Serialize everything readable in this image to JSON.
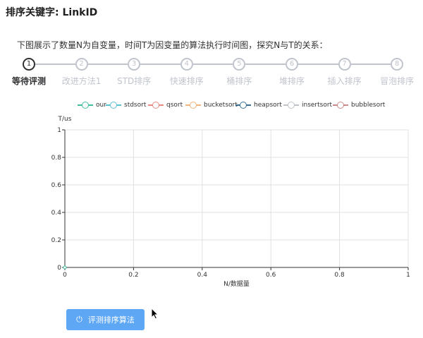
{
  "page_title": "排序关键字: LinkID",
  "description": "下图展示了数量N为自变量，时间T为因变量的算法执行时间图，探究N与T的关系：",
  "steps": [
    {
      "num": "1",
      "label": "等待评测",
      "active": true
    },
    {
      "num": "2",
      "label": "改进方法1",
      "active": false
    },
    {
      "num": "3",
      "label": "STD排序",
      "active": false
    },
    {
      "num": "4",
      "label": "快速排序",
      "active": false
    },
    {
      "num": "5",
      "label": "桶排序",
      "active": false
    },
    {
      "num": "6",
      "label": "堆排序",
      "active": false
    },
    {
      "num": "7",
      "label": "插入排序",
      "active": false
    },
    {
      "num": "8",
      "label": "冒泡排序",
      "active": false
    }
  ],
  "chart_data": {
    "type": "line",
    "ylabel": "T/us",
    "xlabel": "N/数据量",
    "xlim": [
      0,
      1
    ],
    "ylim": [
      0,
      1
    ],
    "x_ticks": [
      "0",
      "0.2",
      "0.4",
      "0.6",
      "0.8",
      "1"
    ],
    "y_ticks": [
      "0",
      "0.2",
      "0.4",
      "0.6",
      "0.8",
      "1"
    ],
    "grid": true,
    "legend_position": "top",
    "series": [
      {
        "name": "our",
        "color": "#3fbf9f",
        "points": [
          [
            0,
            0
          ]
        ]
      },
      {
        "name": "stdsort",
        "color": "#5bc0cf",
        "points": []
      },
      {
        "name": "qsort",
        "color": "#e88a80",
        "points": []
      },
      {
        "name": "bucketsort",
        "color": "#f3b27a",
        "points": []
      },
      {
        "name": "heapsort",
        "color": "#3a6f94",
        "points": []
      },
      {
        "name": "insertsort",
        "color": "#bfc3c9",
        "points": []
      },
      {
        "name": "bubblesort",
        "color": "#c98a8a",
        "points": []
      }
    ]
  },
  "button": {
    "label": "评测排序算法",
    "icon": "power-icon",
    "color": "#5ea7f5"
  }
}
